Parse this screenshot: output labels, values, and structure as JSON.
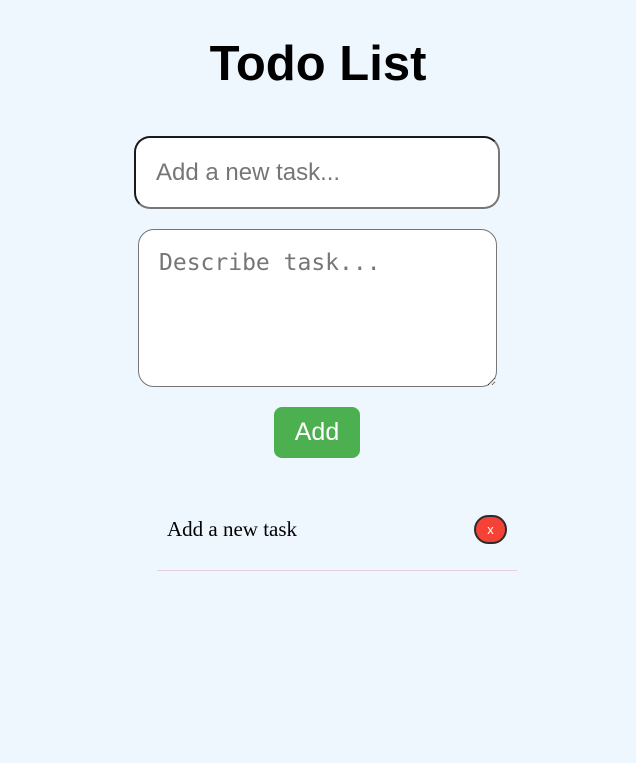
{
  "page": {
    "title": "Todo List"
  },
  "form": {
    "task_input": {
      "value": "",
      "placeholder": "Add a new task..."
    },
    "description_input": {
      "value": "",
      "placeholder": "Describe task..."
    },
    "add_label": "Add"
  },
  "todos": [
    {
      "text": "Add a new task",
      "delete_label": "x"
    }
  ],
  "colors": {
    "background": "#eff7fe",
    "add_button": "#4caf50",
    "delete_button": "#f44336"
  }
}
